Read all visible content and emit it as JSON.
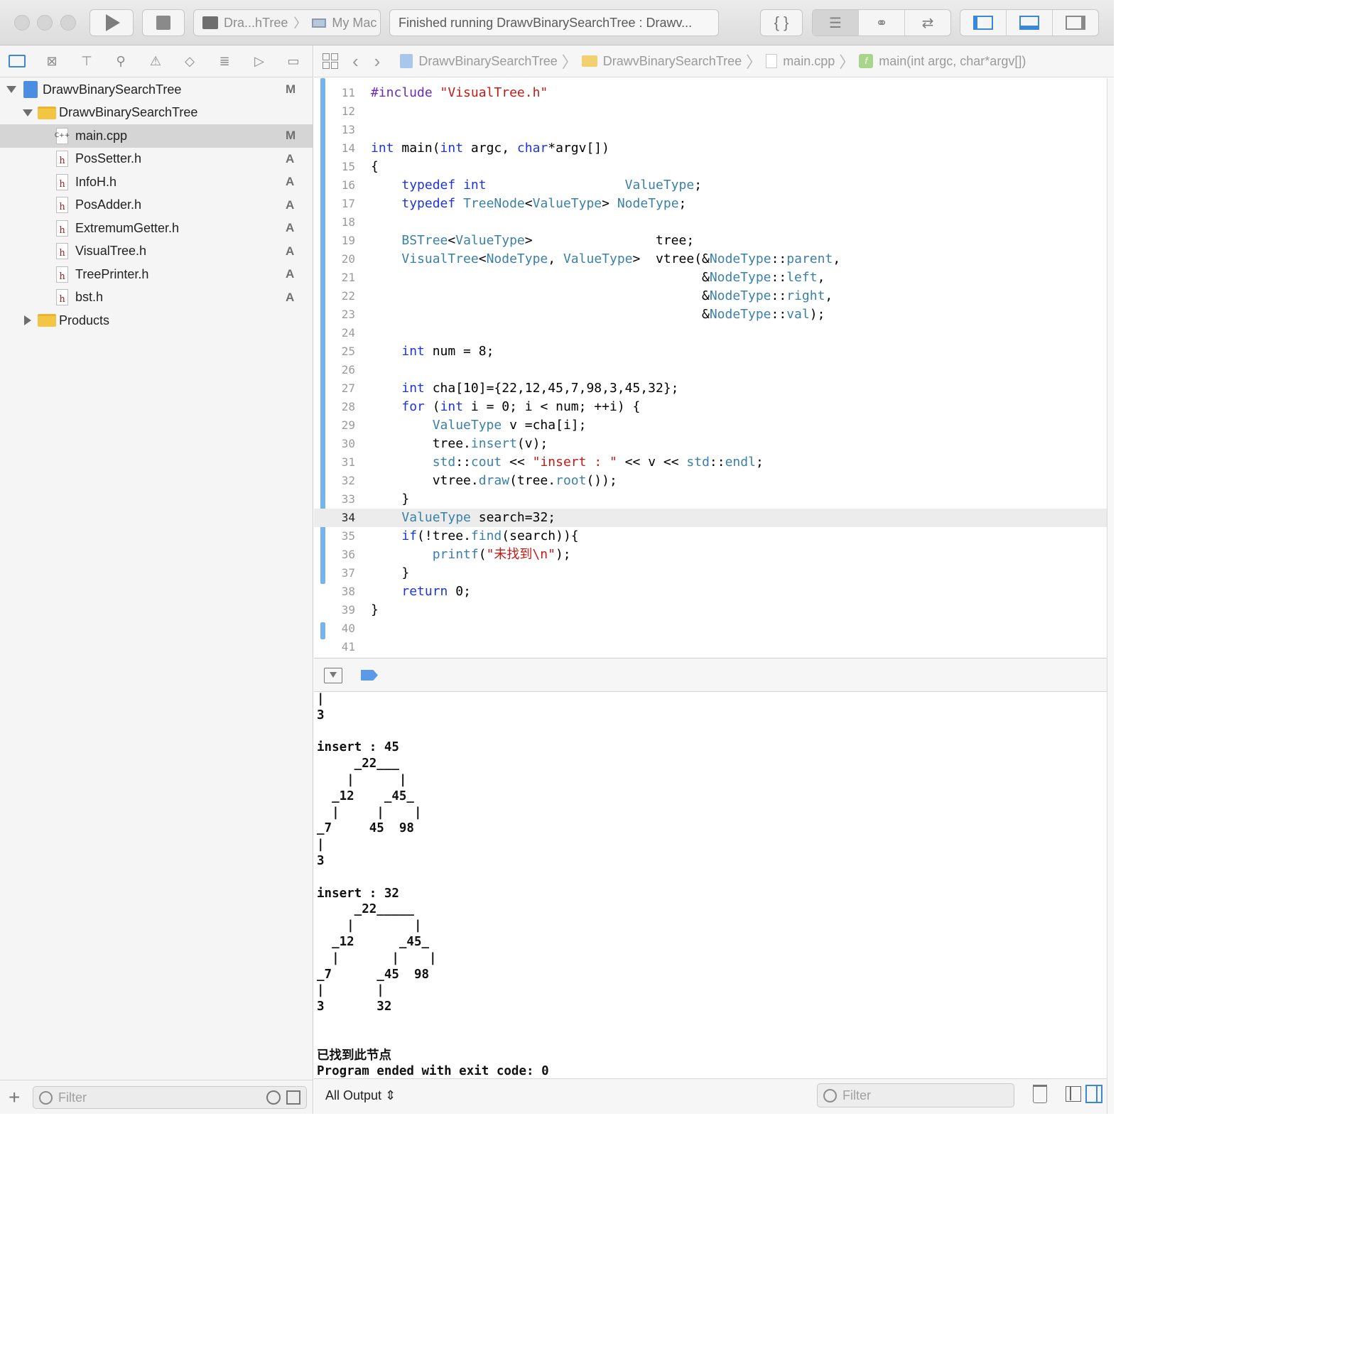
{
  "toolbar": {
    "scheme_name": "Dra...hTree",
    "destination": "My Mac",
    "status_text": "Finished running DrawvBinarySearchTree : Drawv..."
  },
  "navigator": {
    "items": [
      {
        "label": "DrawvBinarySearchTree",
        "badge": "M"
      },
      {
        "label": "DrawvBinarySearchTree",
        "badge": ""
      },
      {
        "label": "main.cpp",
        "badge": "M"
      },
      {
        "label": "PosSetter.h",
        "badge": "A"
      },
      {
        "label": "InfoH.h",
        "badge": "A"
      },
      {
        "label": "PosAdder.h",
        "badge": "A"
      },
      {
        "label": "ExtremumGetter.h",
        "badge": "A"
      },
      {
        "label": "VisualTree.h",
        "badge": "A"
      },
      {
        "label": "TreePrinter.h",
        "badge": "A"
      },
      {
        "label": "bst.h",
        "badge": "A"
      },
      {
        "label": "Products",
        "badge": ""
      }
    ],
    "filter_placeholder": "Filter"
  },
  "jumpbar": {
    "crumbs": [
      "DrawvBinarySearchTree",
      "DrawvBinarySearchTree",
      "main.cpp",
      "main(int argc, char*argv[])"
    ]
  },
  "editor": {
    "current_line": "34",
    "lines": [
      {
        "n": "11",
        "code": "#include \"VisualTree.h\""
      },
      {
        "n": "12",
        "code": ""
      },
      {
        "n": "13",
        "code": ""
      },
      {
        "n": "14",
        "code": "int main(int argc, char*argv[])"
      },
      {
        "n": "15",
        "code": "{"
      },
      {
        "n": "16",
        "code": "    typedef int                  ValueType;"
      },
      {
        "n": "17",
        "code": "    typedef TreeNode<ValueType> NodeType;"
      },
      {
        "n": "18",
        "code": ""
      },
      {
        "n": "19",
        "code": "    BSTree<ValueType>                tree;"
      },
      {
        "n": "20",
        "code": "    VisualTree<NodeType, ValueType>  vtree(&NodeType::parent,"
      },
      {
        "n": "21",
        "code": "                                           &NodeType::left,"
      },
      {
        "n": "22",
        "code": "                                           &NodeType::right,"
      },
      {
        "n": "23",
        "code": "                                           &NodeType::val);"
      },
      {
        "n": "24",
        "code": ""
      },
      {
        "n": "25",
        "code": "    int num = 8;"
      },
      {
        "n": "26",
        "code": ""
      },
      {
        "n": "27",
        "code": "    int cha[10]={22,12,45,7,98,3,45,32};"
      },
      {
        "n": "28",
        "code": "    for (int i = 0; i < num; ++i) {"
      },
      {
        "n": "29",
        "code": "        ValueType v =cha[i];"
      },
      {
        "n": "30",
        "code": "        tree.insert(v);"
      },
      {
        "n": "31",
        "code": "        std::cout << \"insert : \" << v << std::endl;"
      },
      {
        "n": "32",
        "code": "        vtree.draw(tree.root());"
      },
      {
        "n": "33",
        "code": "    }"
      },
      {
        "n": "34",
        "code": "    ValueType search=32;"
      },
      {
        "n": "35",
        "code": "    if(!tree.find(search)){"
      },
      {
        "n": "36",
        "code": "        printf(\"未找到\\n\");"
      },
      {
        "n": "37",
        "code": "    }"
      },
      {
        "n": "38",
        "code": "    return 0;"
      },
      {
        "n": "39",
        "code": "}"
      },
      {
        "n": "40",
        "code": ""
      },
      {
        "n": "41",
        "code": ""
      }
    ]
  },
  "console": {
    "output": "|\n3\n\ninsert : 45\n     _22___\n    |      |\n  _12    _45_\n  |     |    |\n_7     45  98\n|\n3\n\ninsert : 32\n     _22_____\n    |        |\n  _12      _45_\n  |       |    |\n_7      _45  98\n|       |\n3       32\n\n\n已找到此节点\nProgram ended with exit code: 0",
    "output_selector": "All Output",
    "filter_placeholder": "Filter"
  }
}
